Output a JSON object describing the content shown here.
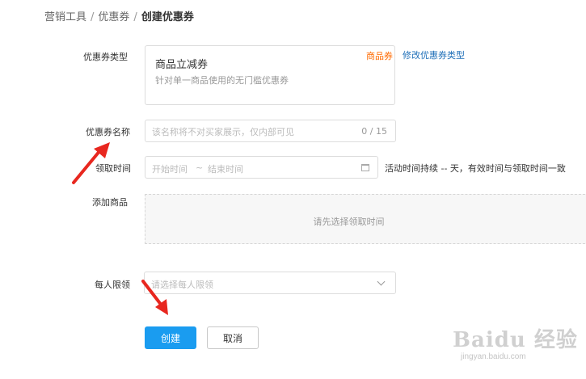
{
  "breadcrumb": {
    "item1": "营销工具",
    "item2": "优惠券",
    "current": "创建优惠券",
    "separator": "/"
  },
  "form": {
    "coupon_type": {
      "label": "优惠券类型",
      "card_title": "商品立减券",
      "card_desc": "针对单一商品使用的无门槛优惠券",
      "card_tag": "商品券",
      "modify_link": "修改优惠券类型"
    },
    "coupon_name": {
      "label": "优惠券名称",
      "placeholder": "该名称将不对买家展示，仅内部可见",
      "value": "",
      "count": "0 / 15"
    },
    "claim_time": {
      "label": "领取时间",
      "start_placeholder": "开始时间",
      "range_sep": "~",
      "end_placeholder": "结束时间",
      "duration_text": "活动时间持续 -- 天，有效时间与领取时间一致"
    },
    "add_product": {
      "label": "添加商品",
      "hint": "请先选择领取时间"
    },
    "per_person_limit": {
      "label": "每人限领",
      "placeholder": "请选择每人限领"
    }
  },
  "buttons": {
    "create": "创建",
    "cancel": "取消"
  },
  "watermark": {
    "logo": "Baidu 经验",
    "url": "jingyan.baidu.com"
  },
  "colors": {
    "primary": "#1a9cf0",
    "tag": "#ff6a00",
    "link": "#1f6fb8",
    "arrow": "#e8271f"
  }
}
